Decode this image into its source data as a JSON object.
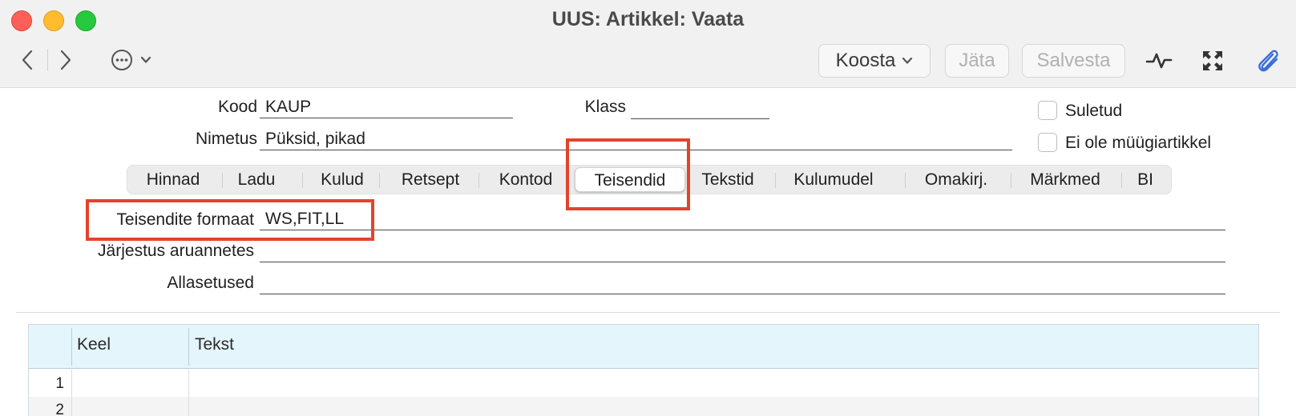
{
  "window": {
    "title": "UUS: Artikkel: Vaata"
  },
  "toolbar": {
    "koosta_label": "Koosta",
    "jata_label": "Jäta",
    "salvesta_label": "Salvesta"
  },
  "form": {
    "kood_label": "Kood",
    "kood_value": "KAUP",
    "klass_label": "Klass",
    "klass_value": "",
    "nimetus_label": "Nimetus",
    "nimetus_value": "Püksid, pikad",
    "suletud_label": "Suletud",
    "ei_ole_label": "Ei ole müügiartikkel"
  },
  "tabs": [
    {
      "label": "Hinnad"
    },
    {
      "label": "Ladu"
    },
    {
      "label": "Kulud"
    },
    {
      "label": "Retsept"
    },
    {
      "label": "Kontod"
    },
    {
      "label": "Teisendid"
    },
    {
      "label": "Tekstid"
    },
    {
      "label": "Kulumudel"
    },
    {
      "label": "Omakirj."
    },
    {
      "label": "Märkmed"
    },
    {
      "label": "BI"
    }
  ],
  "active_tab": "Teisendid",
  "teisendid": {
    "formaat_label": "Teisendite formaat",
    "formaat_value": "WS,FIT,LL",
    "jarjestus_label": "Järjestus aruannetes",
    "jarjestus_value": "",
    "allasetused_label": "Allasetused",
    "allasetused_value": ""
  },
  "grid": {
    "columns": [
      "Keel",
      "Tekst"
    ],
    "rows": [
      {
        "num": "1",
        "keel": "",
        "tekst": ""
      },
      {
        "num": "2",
        "keel": "",
        "tekst": ""
      }
    ]
  },
  "colors": {
    "highlight": "#e4432b",
    "grid_header": "#e4f5fb"
  }
}
